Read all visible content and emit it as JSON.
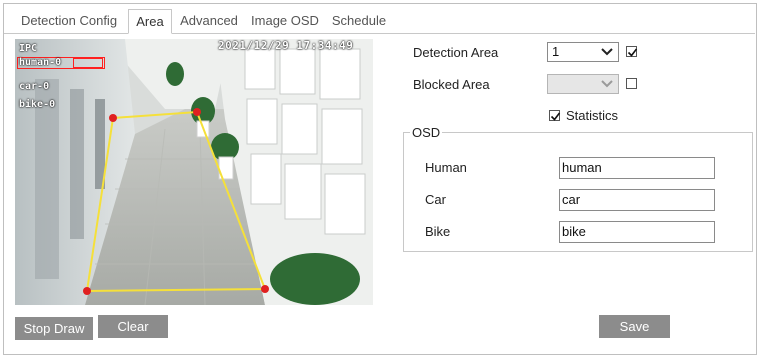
{
  "tabs": [
    {
      "label": "Detection Config",
      "active": false
    },
    {
      "label": "Area",
      "active": true
    },
    {
      "label": "Advanced",
      "active": false
    },
    {
      "label": "Image OSD",
      "active": false
    },
    {
      "label": "Schedule",
      "active": false
    }
  ],
  "video": {
    "timestamp": "2021/12/29 17:34:49",
    "ipc_label": "IPC",
    "human_count": "human-0",
    "car_count": "car-0",
    "bike_count": "bike-0",
    "region_color": "#f5e03a",
    "vertex_color": "#e02020"
  },
  "form": {
    "detection_area_label": "Detection Area",
    "detection_area_value": "1",
    "detection_area_checked": true,
    "blocked_area_label": "Blocked Area",
    "blocked_area_value": "",
    "blocked_area_checked": false,
    "statistics_label": "Statistics",
    "statistics_checked": true
  },
  "osd": {
    "legend": "OSD",
    "human_label": "Human",
    "human_value": "human",
    "car_label": "Car",
    "car_value": "car",
    "bike_label": "Bike",
    "bike_value": "bike"
  },
  "buttons": {
    "stop_draw": "Stop Draw",
    "clear": "Clear",
    "save": "Save"
  },
  "colors": {
    "button_bg": "#8c8c8c",
    "tab_border": "#c8c8c8"
  }
}
